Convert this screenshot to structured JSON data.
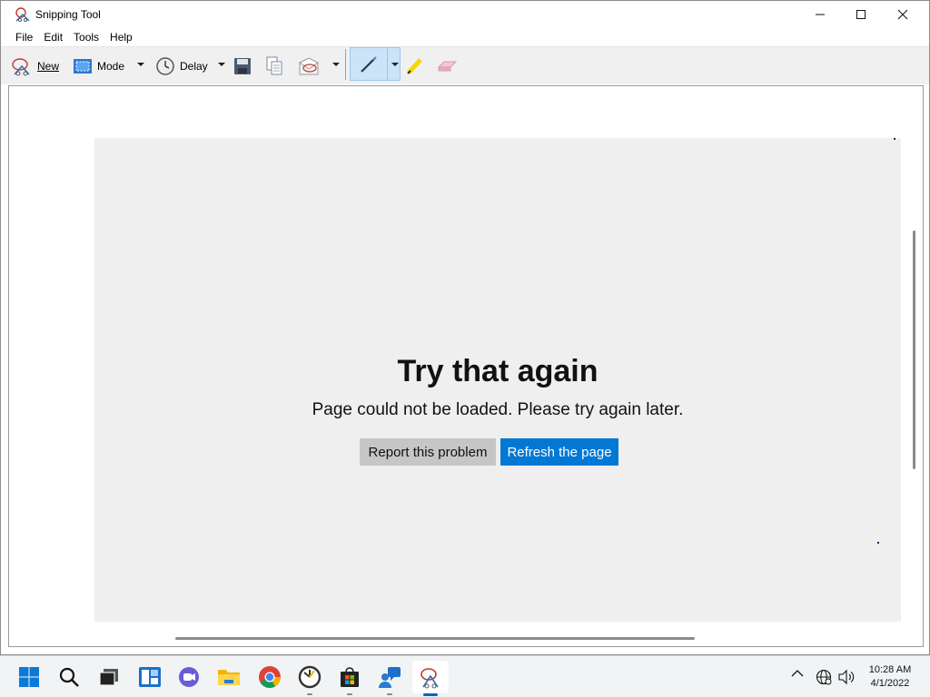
{
  "window": {
    "title": "Snipping Tool"
  },
  "menu": [
    "File",
    "Edit",
    "Tools",
    "Help"
  ],
  "toolbar": {
    "new_label": "New",
    "mode_label": "Mode",
    "delay_label": "Delay"
  },
  "content": {
    "error_title": "Try that again",
    "error_message": "Page could not be loaded. Please try again later.",
    "report_button": "Report this problem",
    "refresh_button": "Refresh the page"
  },
  "taskbar": {
    "icons": [
      "windows-start-icon",
      "search-icon",
      "task-view-icon",
      "widgets-icon",
      "teams-chat-icon",
      "file-explorer-icon",
      "chrome-icon",
      "clock-app-icon",
      "microsoft-store-icon",
      "feedback-hub-icon",
      "snipping-tool-icon"
    ],
    "time": "10:28 AM",
    "date": "4/1/2022"
  },
  "colors": {
    "accent": "#0078d4",
    "error_bg": "#efefef",
    "report_btn_bg": "#c6c6c6",
    "pen_highlight": "#cce4f7"
  }
}
